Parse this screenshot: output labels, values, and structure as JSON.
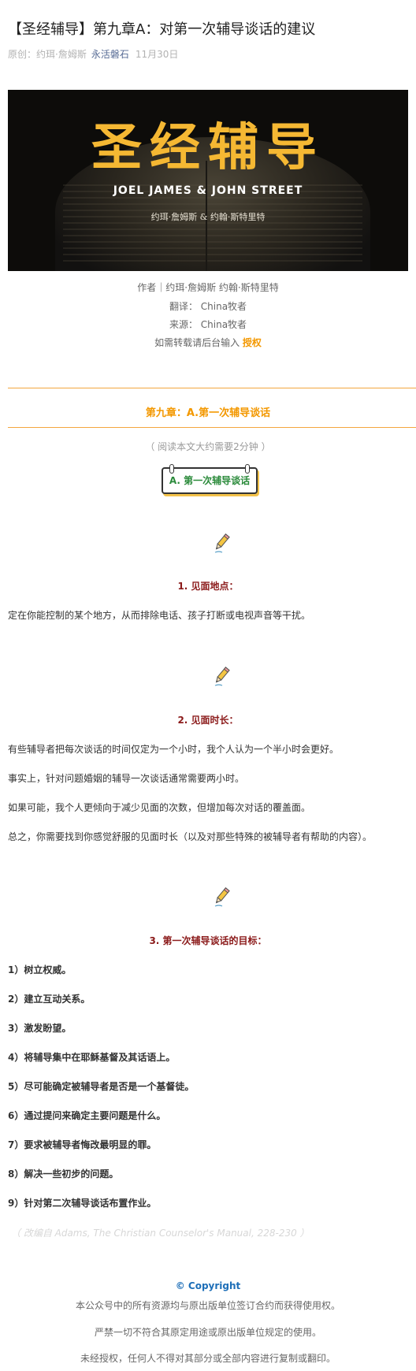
{
  "article": {
    "title": "【圣经辅导】第九章A：对第一次辅导谈话的建议",
    "meta_origin": "原创：约珥·詹姆斯",
    "meta_account": "永活磐石",
    "meta_date": "11月30日"
  },
  "banner": {
    "title": "圣经辅导",
    "authors_en": "JOEL JAMES & JOHN STREET",
    "authors_cn": "约珥·詹姆斯 & 约翰·斯特里特"
  },
  "credits": {
    "author": "作者｜约珥·詹姆斯  约翰·斯特里特",
    "translator": "翻译： China牧者",
    "source": "来源： China牧者",
    "reprint_prefix": "如需转载请后台输入",
    "reprint_keyword": "授权"
  },
  "chapter": {
    "title": "第九章：A.第一次辅导谈话",
    "read_time": "（ 阅读本文大约需要2分钟 ）",
    "section_box": "A. 第一次辅导谈话"
  },
  "sections": [
    {
      "icon": "pencil-icon",
      "heading": "1. 见面地点：",
      "paragraphs": [
        "定在你能控制的某个地方，从而排除电话、孩子打断或电视声音等干扰。"
      ]
    },
    {
      "icon": "pencil-icon",
      "heading": "2. 见面时长：",
      "paragraphs": [
        "有些辅导者把每次谈话的时间仅定为一个小时，我个人认为一个半小时会更好。",
        "事实上，针对问题婚姻的辅导一次谈话通常需要两小时。",
        "如果可能，我个人更倾向于减少见面的次数，但增加每次对话的覆盖面。",
        "总之，你需要找到你感觉舒服的见面时长（以及对那些特殊的被辅导者有帮助的内容）。"
      ]
    },
    {
      "icon": "pencil-icon",
      "heading": "3. 第一次辅导谈话的目标：",
      "items": [
        "1）树立权威。",
        "2）建立互动关系。",
        "3）激发盼望。",
        "4）将辅导集中在耶稣基督及其话语上。",
        "5）尽可能确定被辅导者是否是一个基督徒。",
        "6）通过提问来确定主要问题是什么。",
        "7）要求被辅导者悔改最明显的罪。",
        "8）解决一些初步的问题。",
        "9）针对第二次辅导谈话布置作业。"
      ]
    }
  ],
  "source_note": "（ 改编自 Adams, The Christian Counselor's Manual, 228-230 ）",
  "footer": {
    "copyright": "© Copyright",
    "lines": [
      "本公众号中的所有资源均与原出版单位签订合约而获得使用权。",
      "严禁一切不符合其原定用途或原出版单位规定的使用。",
      "未经授权，任何人不得对其部分或全部内容进行复制或翻印。"
    ]
  },
  "colors": {
    "accent_orange": "#f39800",
    "heading_red": "#8b1a1a",
    "account_blue": "#576b95",
    "copyright_blue": "#1e6fb8",
    "section_green": "#2a8a3a",
    "banner_gold": "#f5b833"
  }
}
